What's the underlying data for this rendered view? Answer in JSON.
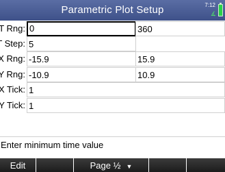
{
  "title": "Parametric Plot Setup",
  "status": {
    "time": "7:12",
    "angle": "∡",
    "battery_color": "#2bd14a"
  },
  "fields": {
    "t_rng": {
      "label": "T Rng:",
      "min": "0",
      "max": "360"
    },
    "t_step": {
      "label": "T Step:",
      "value": "5"
    },
    "x_rng": {
      "label": "X Rng:",
      "min": "-15.9",
      "max": "15.9"
    },
    "y_rng": {
      "label": "Y Rng:",
      "min": "-10.9",
      "max": "10.9"
    },
    "x_tick": {
      "label": "X Tick:",
      "value": "1"
    },
    "y_tick": {
      "label": "Y Tick:",
      "value": "1"
    }
  },
  "help_message": "Enter minimum time value",
  "menu": {
    "edit": "Edit",
    "blank1": "",
    "page": "Page ½",
    "page_arrow": "▼",
    "blank2": "",
    "blank3": ""
  },
  "colors": {
    "titlebar": "#4a5d98",
    "menubar": "#2a2a2a"
  }
}
